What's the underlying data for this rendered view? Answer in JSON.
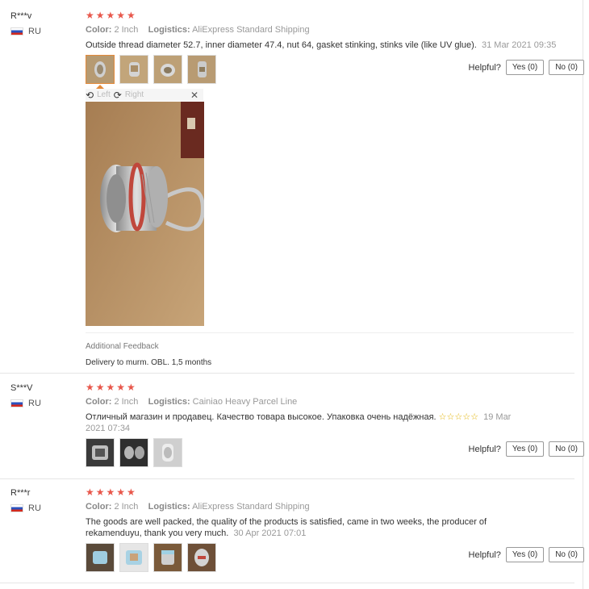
{
  "reviews": [
    {
      "user": "R***v",
      "country": "RU",
      "stars": "★★★★★",
      "color_label": "Color:",
      "color_value": "2 Inch",
      "logistics_label": "Logistics:",
      "logistics_value": "AliExpress Standard Shipping",
      "text": "Outside thread diameter 52.7, inner diameter 47.4, nut 64, gasket stinking, stinks vile (like UV glue).",
      "date": "31 Mar 2021 09:35",
      "helpful_label": "Helpful?",
      "yes_label": "Yes (0)",
      "no_label": "No (0)",
      "viewer": {
        "left_label": "Left",
        "right_label": "Right"
      },
      "additional_title": "Additional Feedback",
      "additional_text": "Delivery to murm. OBL. 1,5 months"
    },
    {
      "user": "S***V",
      "country": "RU",
      "stars": "★★★★★",
      "color_label": "Color:",
      "color_value": "2 Inch",
      "logistics_label": "Logistics:",
      "logistics_value": "Cainiao Heavy Parcel Line",
      "text": "Отличный магазин и продавец. Качество товара высокое. Упаковка очень надёжная.",
      "inline_stars": "☆☆☆☆☆",
      "date": "19 Mar 2021 07:34",
      "helpful_label": "Helpful?",
      "yes_label": "Yes (0)",
      "no_label": "No (0)"
    },
    {
      "user": "R***r",
      "country": "RU",
      "stars": "★★★★★",
      "color_label": "Color:",
      "color_value": "2 Inch",
      "logistics_label": "Logistics:",
      "logistics_value": "AliExpress Standard Shipping",
      "text": "The goods are well packed, the quality of the products is satisfied, came in two weeks, the producer of rekamenduyu, thank you very much.",
      "date": "30 Apr 2021 07:01",
      "helpful_label": "Helpful?",
      "yes_label": "Yes (0)",
      "no_label": "No (0)"
    }
  ]
}
